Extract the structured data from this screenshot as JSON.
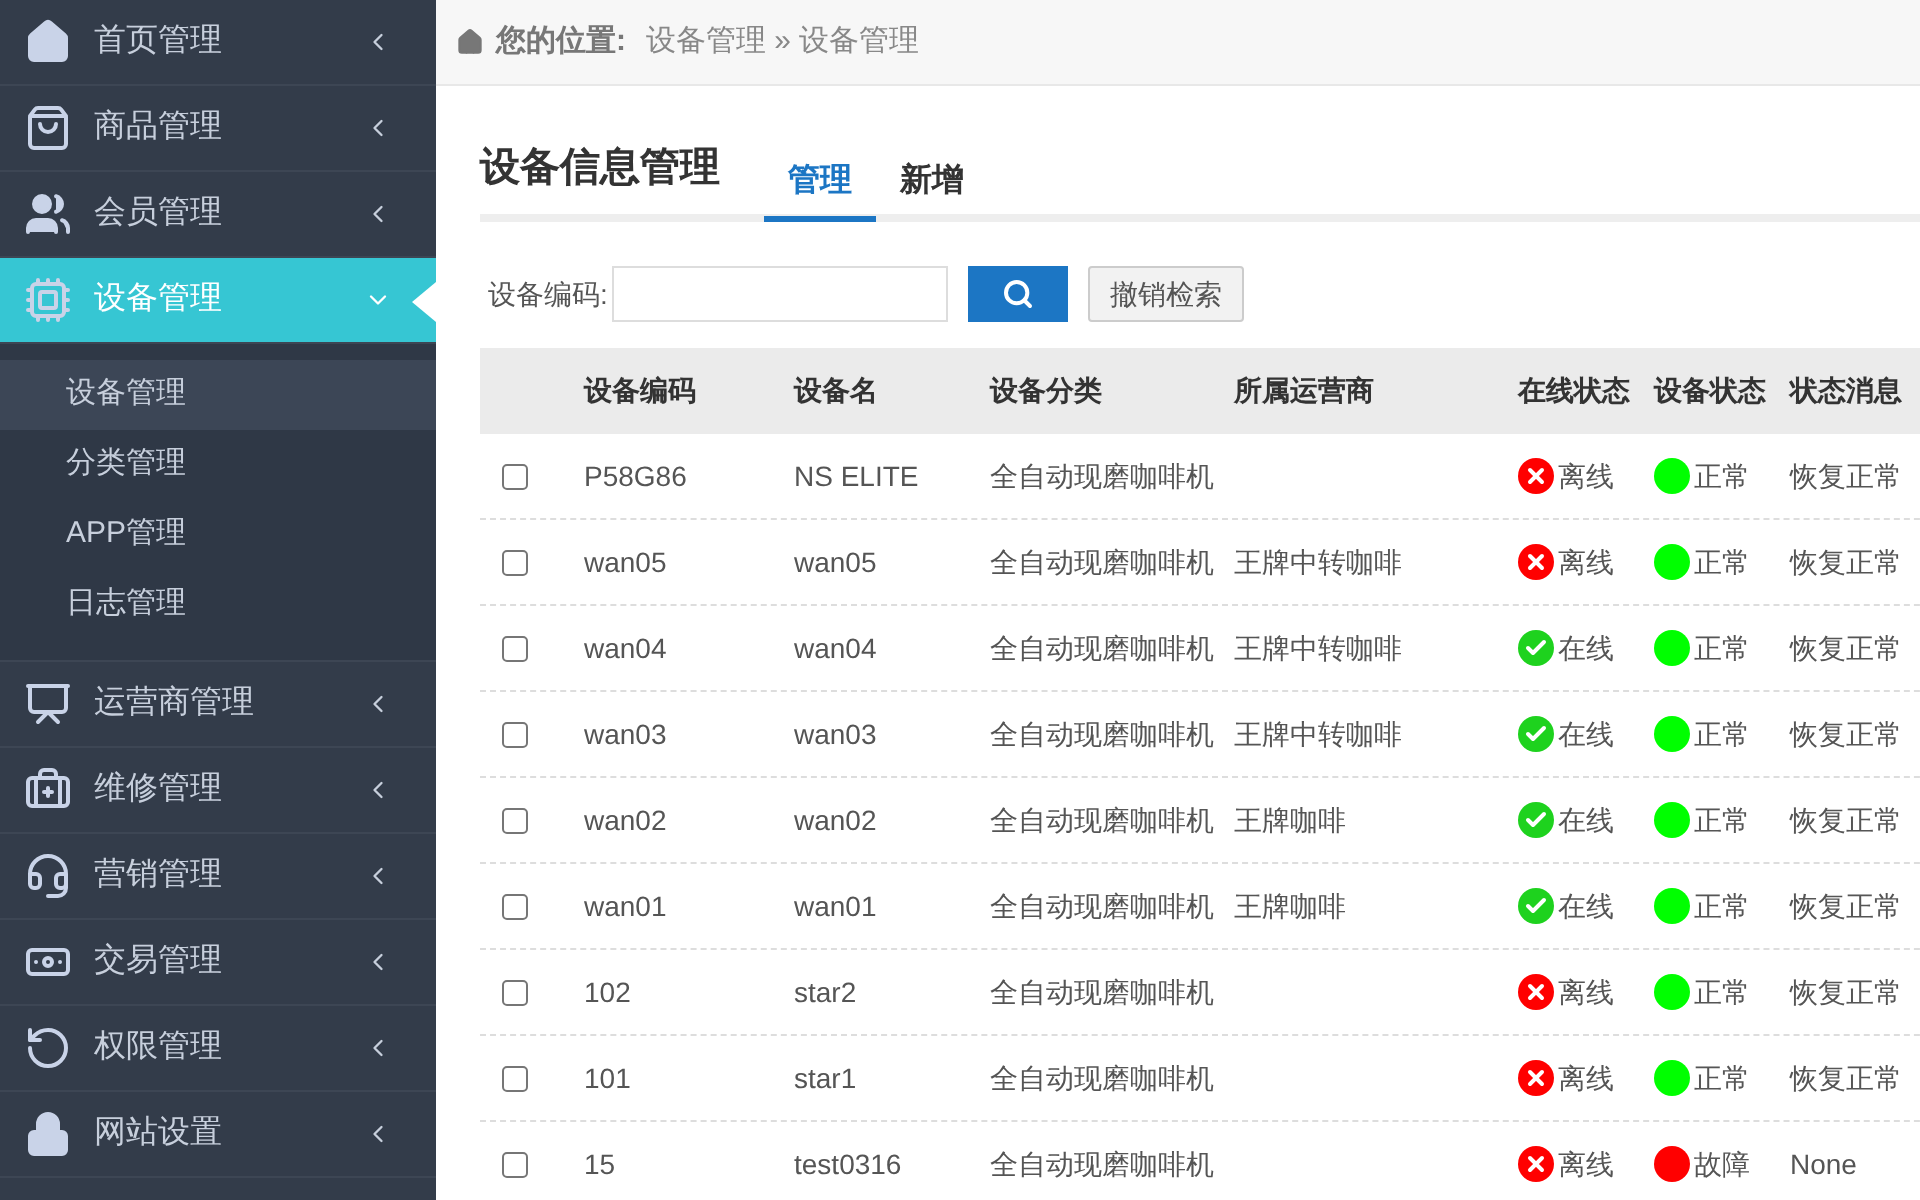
{
  "sidebar": {
    "items": [
      {
        "kind": "home",
        "label": "首页管理",
        "expanded": false,
        "selected": false
      },
      {
        "kind": "bag",
        "label": "商品管理",
        "expanded": false,
        "selected": false
      },
      {
        "kind": "users",
        "label": "会员管理",
        "expanded": false,
        "selected": false
      },
      {
        "kind": "chip",
        "label": "设备管理",
        "expanded": true,
        "selected": true,
        "children": [
          {
            "label": "设备管理",
            "selected": true
          },
          {
            "label": "分类管理",
            "selected": false
          },
          {
            "label": "APP管理",
            "selected": false
          },
          {
            "label": "日志管理",
            "selected": false
          }
        ]
      },
      {
        "kind": "presenter",
        "label": "运营商管理",
        "expanded": false,
        "selected": false
      },
      {
        "kind": "kit",
        "label": "维修管理",
        "expanded": false,
        "selected": false
      },
      {
        "kind": "headset",
        "label": "营销管理",
        "expanded": false,
        "selected": false
      },
      {
        "kind": "money",
        "label": "交易管理",
        "expanded": false,
        "selected": false
      },
      {
        "kind": "refresh",
        "label": "权限管理",
        "expanded": false,
        "selected": false
      },
      {
        "kind": "lock",
        "label": "网站设置",
        "expanded": false,
        "selected": false
      }
    ]
  },
  "breadcrumb": {
    "label": "您的位置:",
    "path": "设备管理 » 设备管理"
  },
  "page_title": "设备信息管理",
  "tabs": [
    {
      "label": "管理",
      "selected": true
    },
    {
      "label": "新增",
      "selected": false
    }
  ],
  "search": {
    "label": "设备编码:",
    "cancel": "撤销检索"
  },
  "table": {
    "columns": [
      "设备编码",
      "设备名",
      "设备分类",
      "所属运营商",
      "在线状态",
      "设备状态",
      "状态消息"
    ],
    "rows": [
      {
        "checked": false,
        "code": "P58G86",
        "name": "NS ELITE",
        "category": "全自动现磨咖啡机",
        "online": false,
        "online_text": "离线",
        "color": "#00ff00",
        "status": "正常",
        "message": "恢复正常"
      },
      {
        "checked": false,
        "code": "wan05",
        "name": "wan05",
        "category": "全自动现磨咖啡机",
        "operator": "王牌中转咖啡",
        "online": false,
        "online_text": "离线",
        "color": "#00ff00",
        "status": "正常",
        "message": "恢复正常"
      },
      {
        "checked": false,
        "code": "wan04",
        "name": "wan04",
        "category": "全自动现磨咖啡机",
        "operator": "王牌中转咖啡",
        "online": true,
        "online_text": "在线",
        "color": "#00ff00",
        "status": "正常",
        "message": "恢复正常"
      },
      {
        "checked": false,
        "code": "wan03",
        "name": "wan03",
        "category": "全自动现磨咖啡机",
        "operator": "王牌中转咖啡",
        "online": true,
        "online_text": "在线",
        "color": "#00ff00",
        "status": "正常",
        "message": "恢复正常"
      },
      {
        "checked": false,
        "code": "wan02",
        "name": "wan02",
        "category": "全自动现磨咖啡机",
        "operator": "王牌咖啡",
        "online": true,
        "online_text": "在线",
        "color": "#00ff00",
        "status": "正常",
        "message": "恢复正常"
      },
      {
        "checked": false,
        "code": "wan01",
        "name": "wan01",
        "category": "全自动现磨咖啡机",
        "operator": "王牌咖啡",
        "online": true,
        "online_text": "在线",
        "color": "#00ff00",
        "status": "正常",
        "message": "恢复正常"
      },
      {
        "checked": false,
        "code": "102",
        "name": "star2",
        "category": "全自动现磨咖啡机",
        "online": false,
        "online_text": "离线",
        "color": "#00ff00",
        "status": "正常",
        "message": "恢复正常"
      },
      {
        "checked": false,
        "code": "101",
        "name": "star1",
        "category": "全自动现磨咖啡机",
        "online": false,
        "online_text": "离线",
        "color": "#00ff00",
        "status": "正常",
        "message": "恢复正常"
      },
      {
        "checked": false,
        "code": "15",
        "name": "test0316",
        "category": "全自动现磨咖啡机",
        "online": false,
        "online_text": "离线",
        "color": "#ff0000",
        "status": "故障",
        "message": "None"
      }
    ]
  }
}
